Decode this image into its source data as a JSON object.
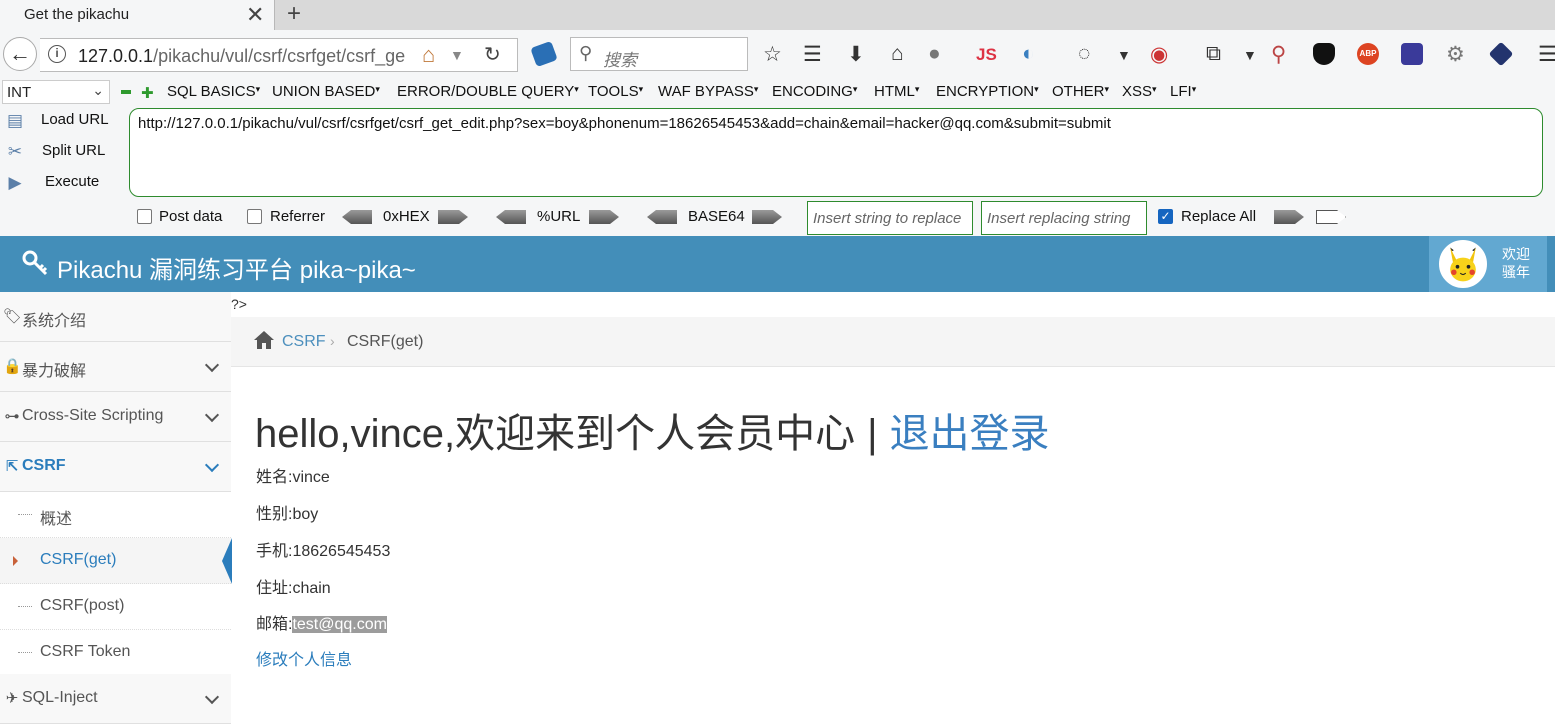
{
  "browser": {
    "tab_title": "Get the pikachu",
    "url_main": "127.0.0.1",
    "url_path": "/pikachu/vul/csrf/csrfget/csrf_ge",
    "search_placeholder": "搜索",
    "js_label": "JS",
    "abp_label": "ABP"
  },
  "hackbar": {
    "select_value": "INT",
    "menus": [
      "SQL BASICS",
      "UNION BASED",
      "ERROR/DOUBLE QUERY",
      "TOOLS",
      "WAF BYPASS",
      "ENCODING",
      "HTML",
      "ENCRYPTION",
      "OTHER",
      "XSS",
      "LFI"
    ],
    "load_url": "Load URL",
    "split_url": "Split URL",
    "execute": "Execute",
    "url_text": "http://127.0.0.1/pikachu/vul/csrf/csrfget/csrf_get_edit.php?sex=boy&phonenum=18626545453&add=chain&email=hacker@qq.com&submit=submit",
    "post_data": "Post data",
    "referrer": "Referrer",
    "hex": "0xHEX",
    "url_enc": "%URL",
    "base64": "BASE64",
    "insert_replace_ph": "Insert string to replace",
    "insert_replacing_ph": "Insert replacing string",
    "replace_all": "Replace All"
  },
  "header": {
    "title": "Pikachu 漏洞练习平台 pika~pika~",
    "welcome": "欢迎",
    "username": "骚年"
  },
  "sidebar": {
    "items": [
      {
        "label": "系统介绍"
      },
      {
        "label": "暴力破解"
      },
      {
        "label": "Cross-Site Scripting"
      },
      {
        "label": "CSRF"
      },
      {
        "label": "SQL-Inject"
      }
    ],
    "csrf_sub": [
      "概述",
      "CSRF(get)",
      "CSRF(post)",
      "CSRF Token"
    ]
  },
  "main": {
    "php_leak": "?>",
    "breadcrumb_1": "CSRF",
    "breadcrumb_2": "CSRF(get)",
    "hello_text": "hello,vince,欢迎来到个人会员中心",
    "logout": "退出登录",
    "name_label": "姓名:",
    "name_value": "vince",
    "sex_label": "性别:",
    "sex_value": "boy",
    "phone_label": "手机:",
    "phone_value": "18626545453",
    "addr_label": "住址:",
    "addr_value": "chain",
    "email_label": "邮箱:",
    "email_value": "test@qq.com",
    "edit_link": "修改个人信息"
  },
  "colors": {
    "header_bg": "#438eb9",
    "link": "#2b7dbc",
    "hackbar_border": "#2e8b2e"
  }
}
